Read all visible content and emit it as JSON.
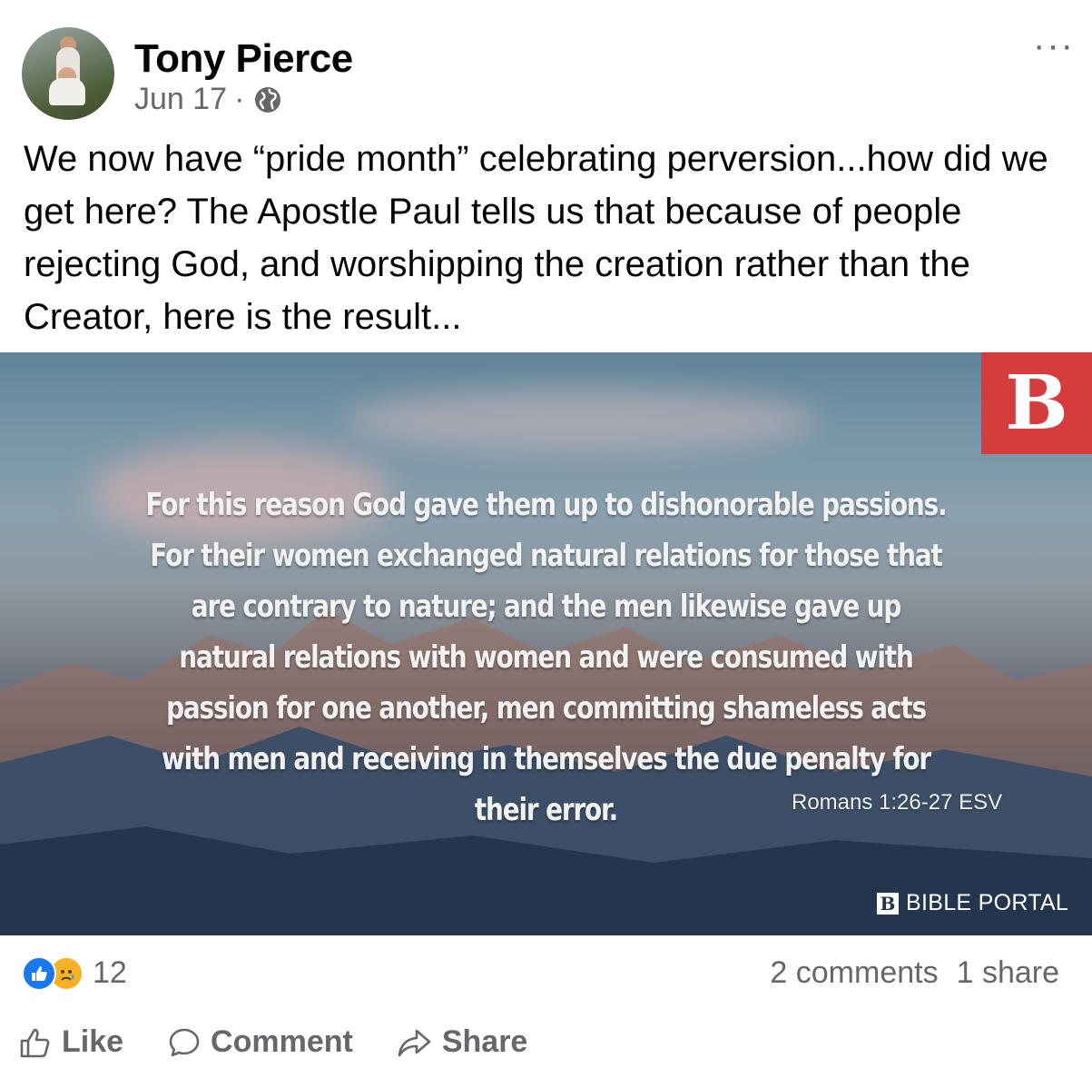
{
  "post": {
    "author": "Tony Pierce",
    "date": "Jun 17",
    "separator": "·",
    "privacy_icon": "globe-icon",
    "more_label": "···",
    "text": "We now have “pride month” celebrating perversion...how did we get here? The Apostle Paul tells us that because of people rejecting God, and worshipping the creation rather than the Creator, here is the result..."
  },
  "image": {
    "logo_letter": "B",
    "verse": "For this reason God gave them up to dishonorable passions. For their women exchanged natural relations for those that are contrary to nature; and the men likewise gave up natural relations with women and were consumed with passion for one another, men committing shameless acts with men and receiving in themselves the due penalty for their error.",
    "reference": "Romans 1:26-27 ESV",
    "portal_icon": "B",
    "portal_name": "BIBLE PORTAL",
    "colors": {
      "logo_bg": "#d63c3b"
    }
  },
  "engagement": {
    "reaction_icons": [
      "like-icon",
      "sad-icon"
    ],
    "reaction_count": "12",
    "comments": "2 comments",
    "shares": "1 share"
  },
  "actions": {
    "like": "Like",
    "comment": "Comment",
    "share": "Share"
  },
  "colors": {
    "like_blue": "#1877f2",
    "secondary_text": "#65676b"
  }
}
